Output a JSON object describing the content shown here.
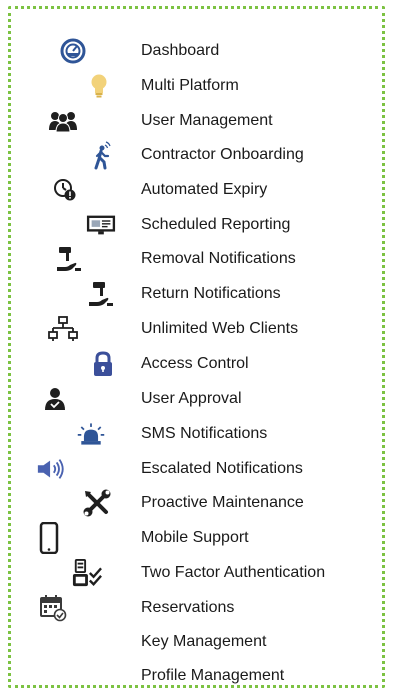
{
  "features": [
    {
      "label": "Dashboard",
      "icon": "dashboard-gauge-icon"
    },
    {
      "label": "Multi Platform",
      "icon": "lightbulb-icon"
    },
    {
      "label": "User Management",
      "icon": "user-group-icon"
    },
    {
      "label": "Contractor Onboarding",
      "icon": "walking-person-icon"
    },
    {
      "label": "Automated Expiry",
      "icon": "clock-alert-icon"
    },
    {
      "label": "Scheduled Reporting",
      "icon": "monitor-report-icon"
    },
    {
      "label": "Removal Notifications",
      "icon": "hand-remove-key-icon"
    },
    {
      "label": "Return Notifications",
      "icon": "hand-return-key-icon"
    },
    {
      "label": "Unlimited Web Clients",
      "icon": "network-tree-icon"
    },
    {
      "label": "Access Control",
      "icon": "padlock-icon"
    },
    {
      "label": "User Approval",
      "icon": "user-approve-icon"
    },
    {
      "label": "SMS Notifications",
      "icon": "alarm-beacon-icon"
    },
    {
      "label": "Escalated Notifications",
      "icon": "speaker-volume-icon"
    },
    {
      "label": "Proactive Maintenance",
      "icon": "wrench-screwdriver-icon"
    },
    {
      "label": "Mobile Support",
      "icon": "smartphone-icon"
    },
    {
      "label": "Two Factor Authentication",
      "icon": "two-factor-checklist-icon"
    },
    {
      "label": "Reservations",
      "icon": "calendar-check-icon"
    },
    {
      "label": "Key Management",
      "icon": ""
    },
    {
      "label": "Profile Management",
      "icon": ""
    }
  ],
  "colors": {
    "border": "#7cc242",
    "text": "#1a1a1a",
    "blue": "#2f5597",
    "icon": "#1f1f1f",
    "bulb": "#f2c94c"
  }
}
